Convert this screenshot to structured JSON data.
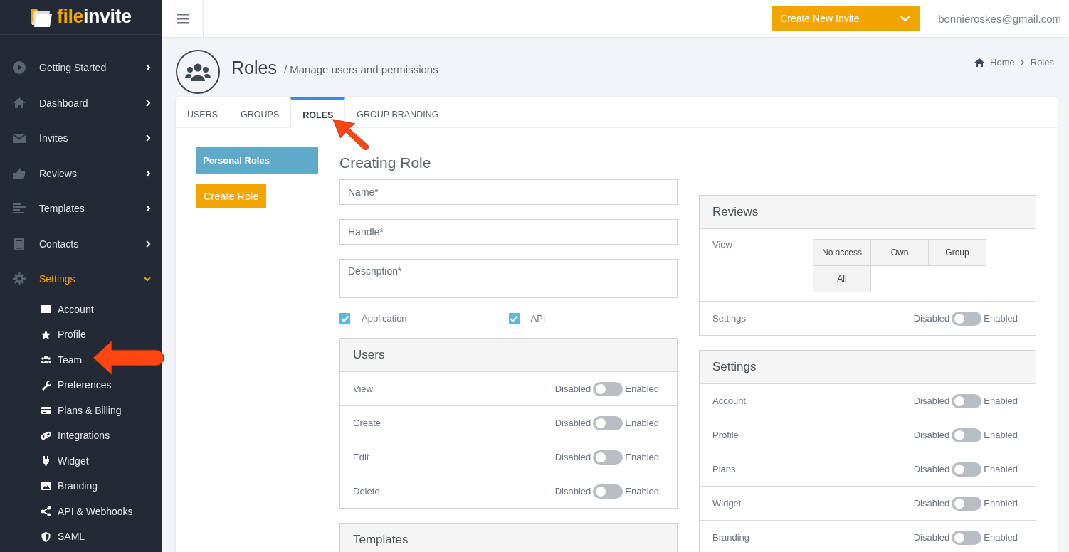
{
  "logo": {
    "text_1": "file",
    "text_2": "invite"
  },
  "sidebar": {
    "items": [
      {
        "label": "Getting Started",
        "expanded": false
      },
      {
        "label": "Dashboard",
        "expanded": false
      },
      {
        "label": "Invites",
        "expanded": false
      },
      {
        "label": "Reviews",
        "expanded": false
      },
      {
        "label": "Templates",
        "expanded": false
      },
      {
        "label": "Contacts",
        "expanded": false
      },
      {
        "label": "Settings",
        "expanded": true,
        "children": [
          {
            "label": "Account"
          },
          {
            "label": "Profile"
          },
          {
            "label": "Team"
          },
          {
            "label": "Preferences"
          },
          {
            "label": "Plans & Billing"
          },
          {
            "label": "Integrations"
          },
          {
            "label": "Widget"
          },
          {
            "label": "Branding"
          },
          {
            "label": "API & Webhooks"
          },
          {
            "label": "SAML"
          }
        ]
      }
    ]
  },
  "topbar": {
    "create_button": "Create New Invite",
    "user_email": "bonnieroskes@gmail.com"
  },
  "page_header": {
    "title": "Roles",
    "subtitle": "/ Manage users and permissions",
    "breadcrumb": [
      "Home",
      "Roles"
    ]
  },
  "tabs": [
    {
      "label": "USERS",
      "selected": false
    },
    {
      "label": "GROUPS",
      "selected": false
    },
    {
      "label": "ROLES",
      "selected": true
    },
    {
      "label": "GROUP BRANDING",
      "selected": false
    }
  ],
  "role_nav": {
    "items": [
      {
        "label": "Personal Roles",
        "selected": true
      }
    ],
    "create_button": "Create Role"
  },
  "form": {
    "title": "Creating Role",
    "fields": [
      {
        "kind": "input",
        "placeholder": "Name*"
      },
      {
        "kind": "input",
        "placeholder": "Handle*"
      },
      {
        "kind": "textarea",
        "placeholder": "Description*"
      }
    ],
    "checkboxes": [
      {
        "label": "Application",
        "checked": true
      },
      {
        "label": "API",
        "checked": true
      }
    ]
  },
  "panels_left": [
    {
      "title": "Users",
      "rows": [
        {
          "kind": "toggle",
          "label": "View",
          "off_label": "Disabled",
          "on_label": "Enabled",
          "on": false
        },
        {
          "kind": "toggle",
          "label": "Create",
          "off_label": "Disabled",
          "on_label": "Enabled",
          "on": false
        },
        {
          "kind": "toggle",
          "label": "Edit",
          "off_label": "Disabled",
          "on_label": "Enabled",
          "on": false
        },
        {
          "kind": "toggle",
          "label": "Delete",
          "off_label": "Disabled",
          "on_label": "Enabled",
          "on": false
        }
      ]
    },
    {
      "title": "Templates"
    }
  ],
  "panels_right": [
    {
      "title": "Reviews",
      "rows": [
        {
          "kind": "choice",
          "label": "View",
          "options": [
            {
              "label": "No access",
              "selected": false
            },
            {
              "label": "Own",
              "selected": false
            },
            {
              "label": "Group",
              "selected": false
            },
            {
              "label": "All",
              "selected": false
            }
          ]
        },
        {
          "kind": "toggle",
          "label": "Settings",
          "off_label": "Disabled",
          "on_label": "Enabled",
          "on": false
        }
      ]
    },
    {
      "title": "Settings",
      "rows": [
        {
          "kind": "toggle",
          "label": "Account",
          "off_label": "Disabled",
          "on_label": "Enabled",
          "on": false
        },
        {
          "kind": "toggle",
          "label": "Profile",
          "off_label": "Disabled",
          "on_label": "Enabled",
          "on": false
        },
        {
          "kind": "toggle",
          "label": "Plans",
          "off_label": "Disabled",
          "on_label": "Enabled",
          "on": false
        },
        {
          "kind": "toggle",
          "label": "Widget",
          "off_label": "Disabled",
          "on_label": "Enabled",
          "on": false
        },
        {
          "kind": "toggle",
          "label": "Branding",
          "off_label": "Disabled",
          "on_label": "Enabled",
          "on": false
        }
      ]
    }
  ]
}
